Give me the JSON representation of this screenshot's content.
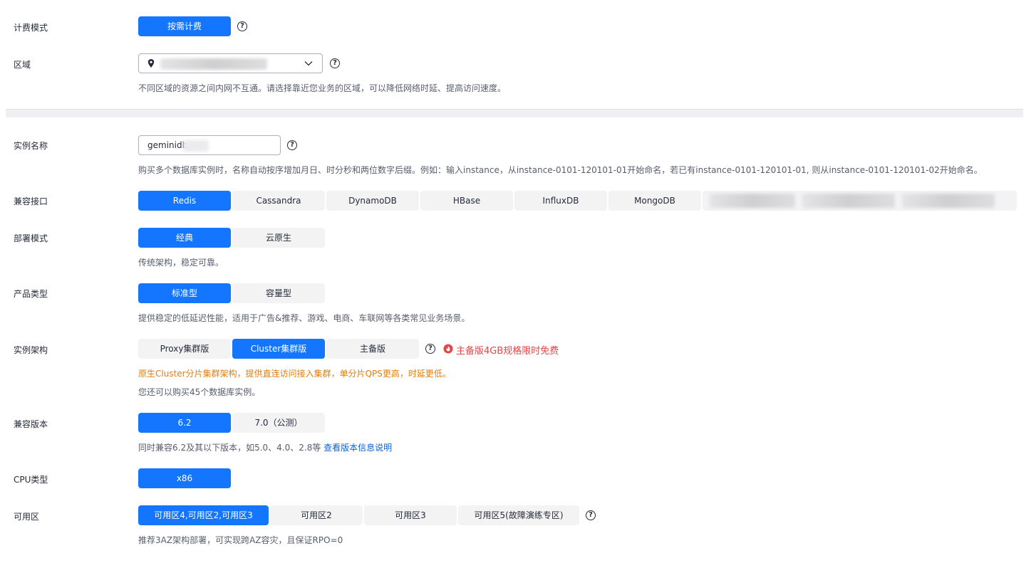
{
  "billing": {
    "label": "计费模式",
    "options": [
      "按需计费"
    ],
    "selected": 0
  },
  "region": {
    "label": "区域",
    "hint": "不同区域的资源之间内网不互通。请选择靠近您业务的区域，可以降低网络时延、提高访问速度。"
  },
  "instance_name": {
    "label": "实例名称",
    "value": "geminidb",
    "hint": "购买多个数据库实例时，名称自动按序增加月日、时分秒和两位数字后缀。例如：输入instance，从instance-0101-120101-01开始命名，若已有instance-0101-120101-01, 则从instance-0101-120101-02开始命名。"
  },
  "compat_api": {
    "label": "兼容接口",
    "options": [
      "Redis",
      "Cassandra",
      "DynamoDB",
      "HBase",
      "InfluxDB",
      "MongoDB"
    ],
    "selected": 0
  },
  "deploy_mode": {
    "label": "部署模式",
    "options": [
      "经典",
      "云原生"
    ],
    "selected": 0,
    "hint": "传统架构，稳定可靠。"
  },
  "product_type": {
    "label": "产品类型",
    "options": [
      "标准型",
      "容量型"
    ],
    "selected": 0,
    "hint": "提供稳定的低延迟性能，适用于广告&推荐、游戏、电商、车联网等各类常见业务场景。"
  },
  "architecture": {
    "label": "实例架构",
    "options": [
      "Proxy集群版",
      "Cluster集群版",
      "主备版"
    ],
    "selected": 1,
    "promo": "主备版4GB规格限时免费",
    "warning": "原生Cluster分片集群架构，提供直连访问接入集群，单分片QPS更高，时延更低。",
    "quota": "您还可以购买45个数据库实例。"
  },
  "version": {
    "label": "兼容版本",
    "options": [
      "6.2",
      "7.0（公测）"
    ],
    "selected": 0,
    "hint": "同时兼容6.2及其以下版本，如5.0、4.0、2.8等",
    "link": "查看版本信息说明"
  },
  "cpu": {
    "label": "CPU类型",
    "options": [
      "x86"
    ],
    "selected": 0
  },
  "az": {
    "label": "可用区",
    "options": [
      "可用区4,可用区2,可用区3",
      "可用区2",
      "可用区3",
      "可用区5(故障演练专区)"
    ],
    "selected": 0,
    "hint": "推荐3AZ架构部署，可实现跨AZ容灾，且保证RPO=0"
  },
  "colors": {
    "primary": "#1476ff",
    "warning": "#e37d0a",
    "promo": "#e54545",
    "link": "#0e5fd8"
  }
}
